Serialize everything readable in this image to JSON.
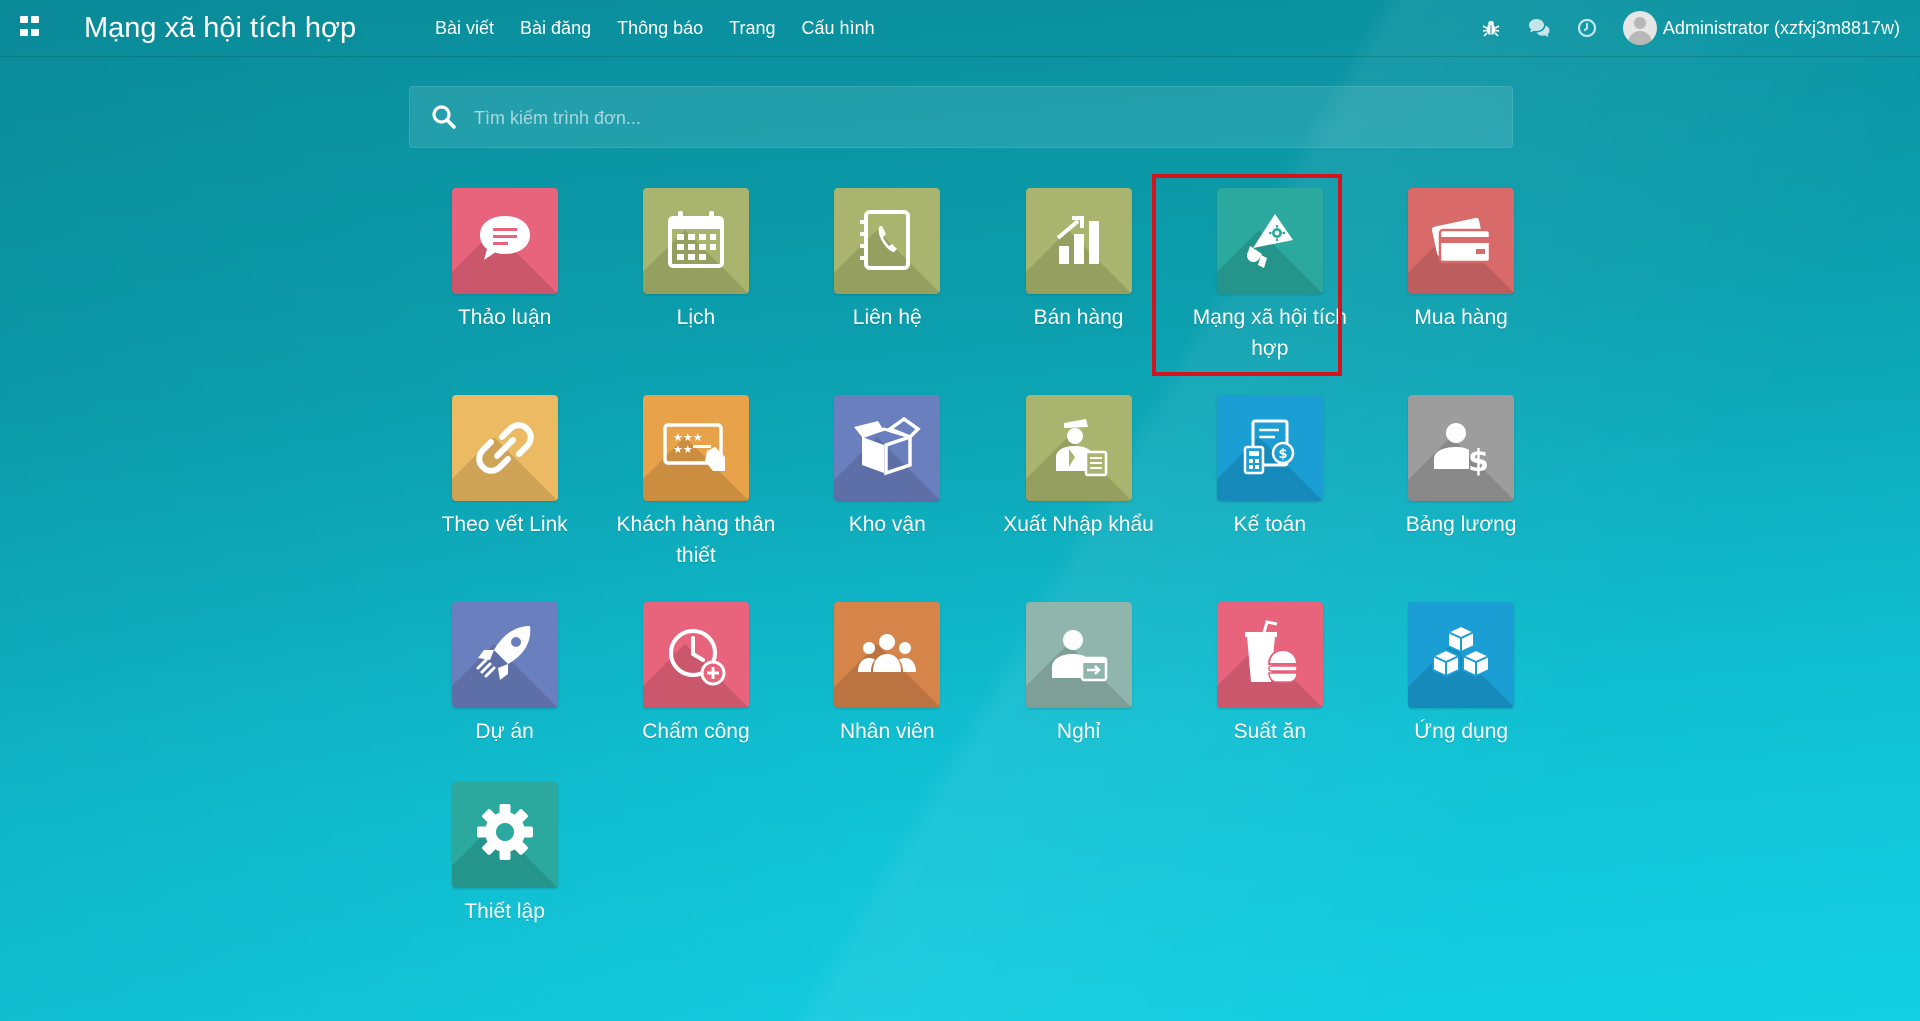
{
  "header": {
    "brand": "Mạng xã hội tích hợp",
    "menu": [
      "Bài viết",
      "Bài đăng",
      "Thông báo",
      "Trang",
      "Cấu hình"
    ],
    "user": "Administrator (xzfxj3m8817w)",
    "tray_icons": [
      "bug-icon",
      "chat-icon",
      "clock-icon"
    ]
  },
  "search": {
    "placeholder": "Tìm kiếm trình đơn...",
    "value": ""
  },
  "apps": [
    {
      "label": "Thảo luận",
      "icon": "discuss-icon",
      "color": "#e8647c"
    },
    {
      "label": "Lịch",
      "icon": "calendar-icon",
      "color": "#a9b56e"
    },
    {
      "label": "Liên hệ",
      "icon": "contacts-icon",
      "color": "#a9b56e"
    },
    {
      "label": "Bán hàng",
      "icon": "sales-chart-icon",
      "color": "#a9b56e"
    },
    {
      "label": "Mạng xã hội tích hợp",
      "icon": "megaphone-icon",
      "color": "#2ba99e"
    },
    {
      "label": "Mua hàng",
      "icon": "credit-card-icon",
      "color": "#d86a6a"
    },
    {
      "label": "Theo vết Link",
      "icon": "link-icon",
      "color": "#ecba62"
    },
    {
      "label": "Khách hàng thân thiết",
      "icon": "loyalty-card-icon",
      "color": "#e8a24a"
    },
    {
      "label": "Kho vận",
      "icon": "box-icon",
      "color": "#6a7fbd"
    },
    {
      "label": "Xuất Nhập khẩu",
      "icon": "customs-officer-icon",
      "color": "#a9b56e"
    },
    {
      "label": "Kế toán",
      "icon": "invoice-calculator-icon",
      "color": "#1a9ed4"
    },
    {
      "label": "Bảng lương",
      "icon": "payroll-icon",
      "color": "#9d9d9d"
    },
    {
      "label": "Dự án",
      "icon": "rocket-icon",
      "color": "#6a7fbd"
    },
    {
      "label": "Chấm công",
      "icon": "timesheet-icon",
      "color": "#e8647c"
    },
    {
      "label": "Nhân viên",
      "icon": "employees-icon",
      "color": "#d5844a"
    },
    {
      "label": "Nghỉ",
      "icon": "leave-icon",
      "color": "#8fb5ad"
    },
    {
      "label": "Suất ăn",
      "icon": "meal-icon",
      "color": "#e8647c"
    },
    {
      "label": "Ứng dụng",
      "icon": "cubes-icon",
      "color": "#1a9ed4"
    },
    {
      "label": "Thiết lập",
      "icon": "gear-icon",
      "color": "#2ba99e"
    }
  ],
  "highlighted_app": "Mạng xã hội tích hợp",
  "highlight_color": "#d4141c"
}
